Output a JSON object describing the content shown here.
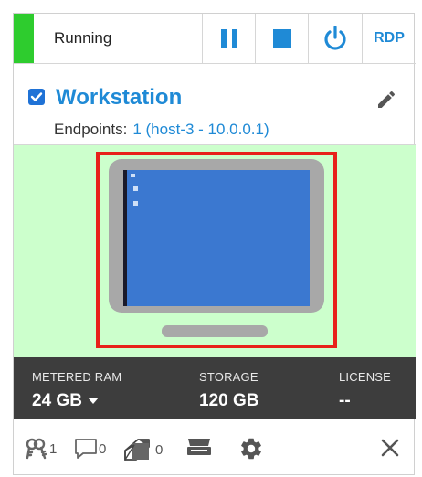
{
  "status": {
    "label": "Running",
    "color": "#2ecc2e"
  },
  "controls": {
    "rdp_label": "RDP"
  },
  "vm": {
    "name": "Workstation",
    "checked": true,
    "endpoints_label": "Endpoints:",
    "endpoints_value": "1 (host-3 - 10.0.0.1)"
  },
  "metrics": {
    "ram": {
      "label": "METERED RAM",
      "value": "24 GB"
    },
    "storage": {
      "label": "STORAGE",
      "value": "120 GB"
    },
    "license": {
      "label": "LICENSE",
      "value": "--"
    }
  },
  "footer": {
    "keys_count": "1",
    "comments_count": "0",
    "tags_count": "0"
  },
  "colors": {
    "accent": "#1f8ad6",
    "preview_bg": "#ccffcc",
    "highlight": "#e8201a",
    "metrics_bg": "#3d3d3d"
  }
}
